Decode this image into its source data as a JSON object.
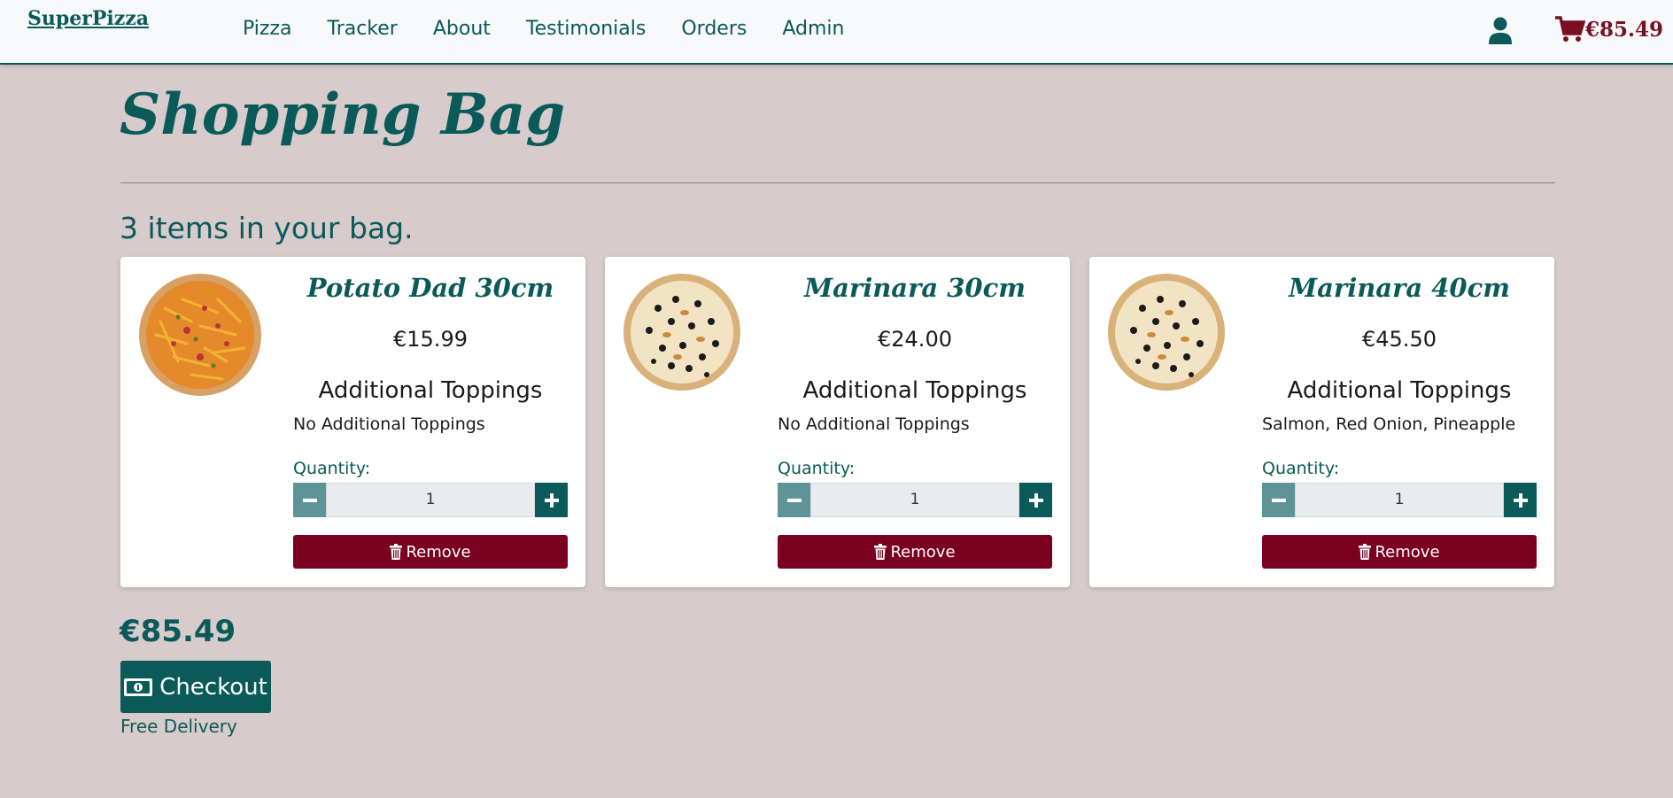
{
  "navbar": {
    "brand": "SuperPizza",
    "links": [
      "Pizza",
      "Tracker",
      "About",
      "Testimonials",
      "Orders",
      "Admin"
    ],
    "cart_total": "€85.49",
    "user_icon": "user-icon",
    "cart_icon": "shopping-cart-icon",
    "cart_color": "#7a0f22"
  },
  "page": {
    "title": "Shopping Bag",
    "items_count": "3 items in your bag."
  },
  "items": [
    {
      "name": "Potato Dad 30cm",
      "price": "€15.99",
      "toppings_heading": "Additional Toppings",
      "toppings": "No Additional Toppings",
      "quantity_label": "Quantity:",
      "quantity": "1",
      "remove_label": "Remove",
      "image": "potato-pizza-image"
    },
    {
      "name": "Marinara 30cm",
      "price": "€24.00",
      "toppings_heading": "Additional Toppings",
      "toppings": "No Additional Toppings",
      "quantity_label": "Quantity:",
      "quantity": "1",
      "remove_label": "Remove",
      "image": "marinara-pizza-image"
    },
    {
      "name": "Marinara 40cm",
      "price": "€45.50",
      "toppings_heading": "Additional Toppings",
      "toppings": "Salmon, Red Onion, Pineapple",
      "quantity_label": "Quantity:",
      "quantity": "1",
      "remove_label": "Remove",
      "image": "marinara-pizza-image"
    }
  ],
  "summary": {
    "total": "€85.49",
    "checkout_label": "Checkout",
    "delivery_note": "Free Delivery"
  },
  "colors": {
    "primary": "#0b5a5a",
    "danger": "#7a0020",
    "background": "#d7cbcb"
  }
}
